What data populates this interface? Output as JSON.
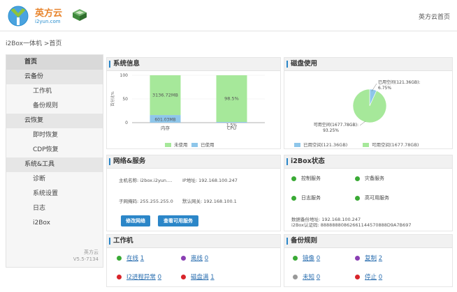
{
  "header": {
    "logo_cn": "英方云",
    "logo_en": "i2yun.com",
    "home_link": "英方云首页"
  },
  "breadcrumb": "i2Box一体机 >首页",
  "sidebar": {
    "items": [
      {
        "label": "首页",
        "kind": "head",
        "active": true
      },
      {
        "label": "云备份",
        "kind": "head"
      },
      {
        "label": "工作机",
        "kind": "sub"
      },
      {
        "label": "备份规则",
        "kind": "sub"
      },
      {
        "label": "云恢复",
        "kind": "head"
      },
      {
        "label": "即时恢复",
        "kind": "sub"
      },
      {
        "label": "CDP恢复",
        "kind": "sub"
      },
      {
        "label": "系统&工具",
        "kind": "head"
      },
      {
        "label": "诊断",
        "kind": "sub"
      },
      {
        "label": "系统设置",
        "kind": "sub"
      },
      {
        "label": "日志",
        "kind": "sub"
      },
      {
        "label": "i2Box",
        "kind": "sub"
      }
    ],
    "footer_brand": "英方云",
    "footer_version": "V5.5-7134"
  },
  "system_panel": {
    "title": "系统信息",
    "ylabel": "百分比%",
    "legend_unused": "未使用",
    "legend_used": "已使用"
  },
  "disk_panel": {
    "title": "磁盘使用",
    "used_label_line1": "已用空间(121.36GB):",
    "used_label_line2": "6.75%",
    "free_label_line1": "可用空间(1677.78GB):",
    "free_label_line2": "93.25%",
    "legend_used": "已用空间(121.36GB)",
    "legend_free": "可用空间(1677.78GB)"
  },
  "network_panel": {
    "title": "网络&服务",
    "hostname": "主机名称: i2box.i2yun....",
    "ip": "IP地址: 192.168.100.247",
    "netmask": "子网掩码: 255.255.255.0",
    "gateway": "默认网关: 192.168.100.1",
    "btn_modify": "修改网络",
    "btn_services": "查看可用服务"
  },
  "i2box_panel": {
    "title": "i2Box状态",
    "services": [
      "控制服务",
      "灾备服务",
      "日志服务",
      "高可用服务"
    ],
    "data_addr": "数据备份地址: 192.168.100.247",
    "auth_code": "i2Box认证码: 88888880862661144570888D9A7B697"
  },
  "workers_panel": {
    "title": "工作机",
    "stats": [
      {
        "label": "在线",
        "value": "1",
        "color": "#3aaa35"
      },
      {
        "label": "离线",
        "value": "0",
        "color": "#8a3fb3"
      },
      {
        "label": "I2进程异常",
        "value": "0",
        "color": "#d8242a"
      },
      {
        "label": "磁盘满",
        "value": "1",
        "color": "#d8242a"
      }
    ]
  },
  "backup_panel": {
    "title": "备份规则",
    "stats": [
      {
        "label": "镜像",
        "value": "0",
        "color": "#3aaa35"
      },
      {
        "label": "复制",
        "value": "2",
        "color": "#8a3fb3"
      },
      {
        "label": "未知",
        "value": "0",
        "color": "#999999"
      },
      {
        "label": "停止",
        "value": "0",
        "color": "#d8242a"
      }
    ]
  },
  "colors": {
    "accent": "#2b86c8",
    "unused_green": "#a6e89a",
    "used_blue": "#8ec6ea"
  },
  "chart_data": [
    {
      "type": "bar",
      "stacked": true,
      "categories": [
        "内存",
        "CPU"
      ],
      "series": [
        {
          "name": "已使用",
          "values": [
            601.03,
            1.5
          ],
          "labels": [
            "601.03MB",
            "1.5%"
          ]
        },
        {
          "name": "未使用",
          "values": [
            3136.72,
            98.5
          ],
          "labels": [
            "3136.72MB",
            "98.5%"
          ]
        }
      ],
      "ylabel": "百分比%",
      "yticks": [
        0,
        50,
        100
      ],
      "ylim": [
        0,
        100
      ],
      "legend": "bottom"
    },
    {
      "type": "pie",
      "slices": [
        {
          "name": "已用空间(121.36GB)",
          "value": 6.75
        },
        {
          "name": "可用空间(1677.78GB)",
          "value": 93.25
        }
      ],
      "legend": "bottom"
    }
  ]
}
